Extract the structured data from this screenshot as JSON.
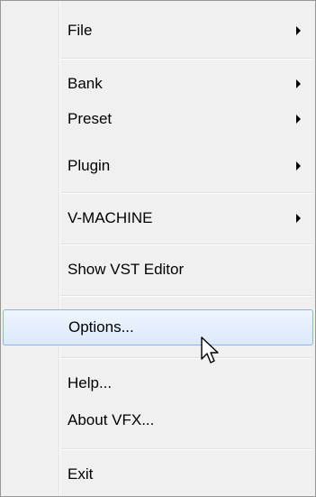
{
  "menu": {
    "file": {
      "label": "File",
      "arrow": "submenu-arrow-icon"
    },
    "bank": {
      "label": "Bank",
      "arrow": "submenu-arrow-icon"
    },
    "preset": {
      "label": "Preset",
      "arrow": "submenu-arrow-icon"
    },
    "plugin": {
      "label": "Plugin",
      "arrow": "submenu-arrow-icon"
    },
    "vmachine": {
      "label": "V-MACHINE",
      "arrow": "submenu-arrow-icon"
    },
    "show_vst_editor": {
      "label": "Show VST Editor"
    },
    "options": {
      "label": "Options...",
      "state": "hovered"
    },
    "help": {
      "label": "Help..."
    },
    "about": {
      "label": "About VFX..."
    },
    "exit": {
      "label": "Exit"
    }
  },
  "colors": {
    "menu_bg": "#f0f0f0",
    "hover_border": "#8eb4e2",
    "hover_bg": "#dbe9fa",
    "text": "#000000"
  },
  "cursor": {
    "icon": "mouse-pointer-icon"
  }
}
